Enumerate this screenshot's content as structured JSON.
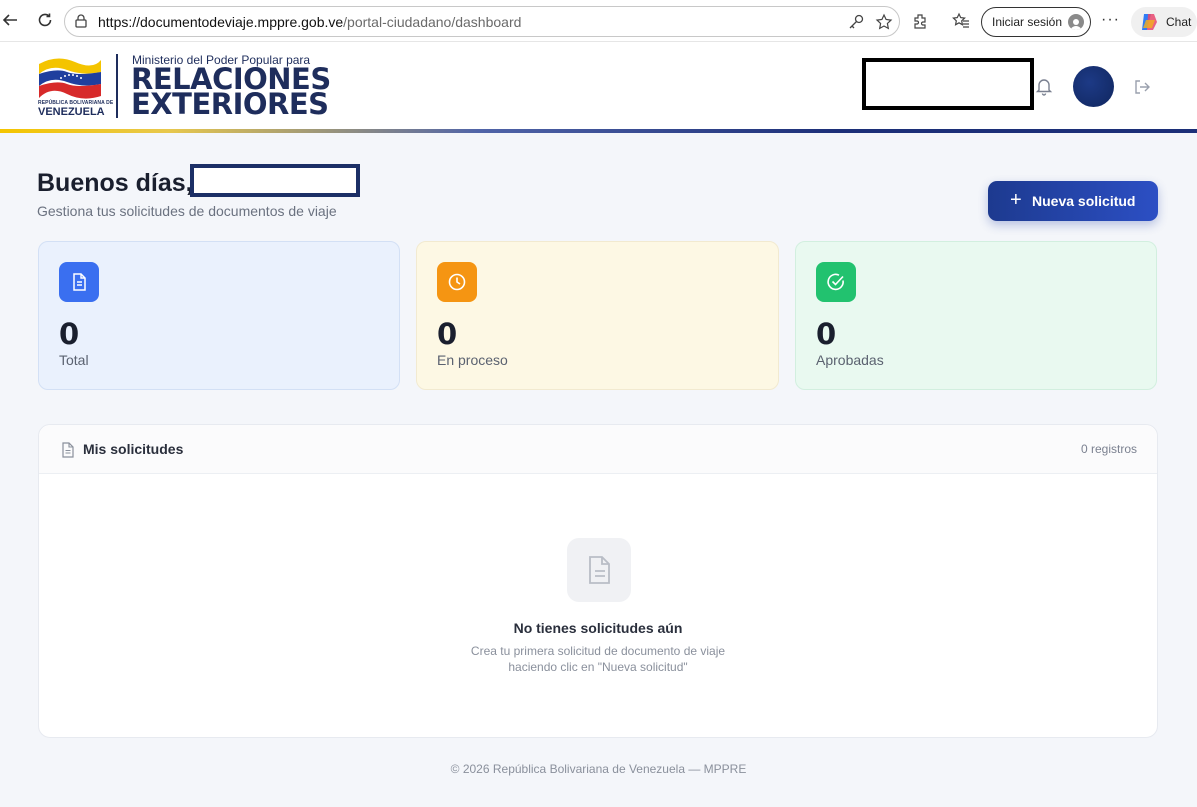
{
  "browser": {
    "url_host": "https://documentodeviaje.mppre.gob.ve",
    "url_path": "/portal-ciudadano/dashboard",
    "signin_label": "Iniciar sesión",
    "more_label": "···",
    "chat_label": "Chat"
  },
  "header": {
    "logo_small_line1": "REPÚBLICA BOLIVARIANA DE",
    "logo_small_line2": "VENEZUELA",
    "ministry": "Ministerio del Poder Popular para",
    "title_line1": "RELACIONES",
    "title_line2": "EXTERIORES"
  },
  "greeting": {
    "text": "Buenos días,",
    "subtitle": "Gestiona tus solicitudes de documentos de viaje"
  },
  "new_request": {
    "plus": "+",
    "label": "Nueva solicitud"
  },
  "stats": [
    {
      "value": "0",
      "label": "Total",
      "icon": "document-icon",
      "color": "#3a6ff0"
    },
    {
      "value": "0",
      "label": "En proceso",
      "icon": "clock-icon",
      "color": "#f59512"
    },
    {
      "value": "0",
      "label": "Aprobadas",
      "icon": "check-circle-icon",
      "color": "#22c26f"
    }
  ],
  "requests": {
    "title": "Mis solicitudes",
    "count": "0 registros",
    "empty_title": "No tienes solicitudes aún",
    "empty_desc_line1": "Crea tu primera solicitud de documento de viaje",
    "empty_desc_line2": "haciendo clic en \"Nueva solicitud\""
  },
  "footer": "© 2026 República Bolivariana de Venezuela — MPPRE"
}
